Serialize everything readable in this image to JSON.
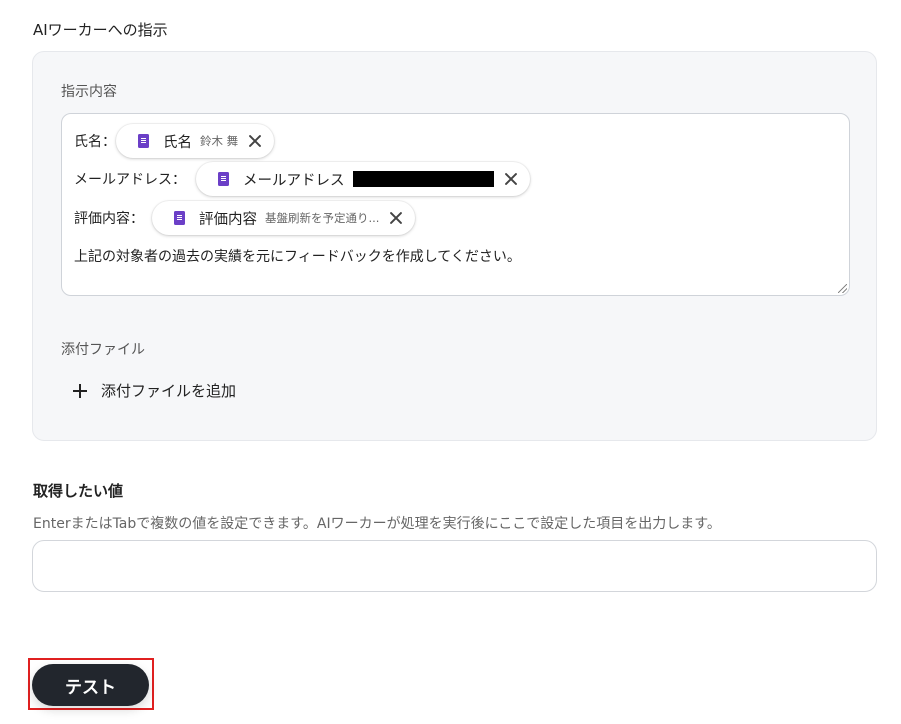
{
  "ai_instructions": {
    "title": "AIワーカーへの指示",
    "content_label": "指示内容",
    "lines": [
      {
        "label": "氏名：",
        "chip_name": "氏名",
        "chip_value": "鈴木 舞"
      },
      {
        "label": "メールアドレス：",
        "chip_name": "メールアドレス",
        "chip_value_redacted": true
      },
      {
        "label": "評価内容：",
        "chip_name": "評価内容",
        "chip_value": "基盤刷新を予定通り..."
      }
    ],
    "instruction_text": "上記の対象者の過去の実績を元にフィードバックを作成してください。",
    "attachment_label": "添付ファイル",
    "add_attachment": "添付ファイルを追加"
  },
  "output_values": {
    "title": "取得したい値",
    "help_text": "EnterまたはTabで複数の値を設定できます。AIワーカーが処理を実行後にここで設定した項目を出力します。",
    "input_value": "",
    "input_placeholder": ""
  },
  "actions": {
    "test_label": "テスト"
  },
  "colors": {
    "chip_icon": "#6b3fc7",
    "test_button_bg": "#22262d",
    "highlight_border": "#e02020"
  },
  "icons": {
    "chip": "document-icon",
    "chip_remove": "close-icon",
    "add": "plus-icon"
  }
}
